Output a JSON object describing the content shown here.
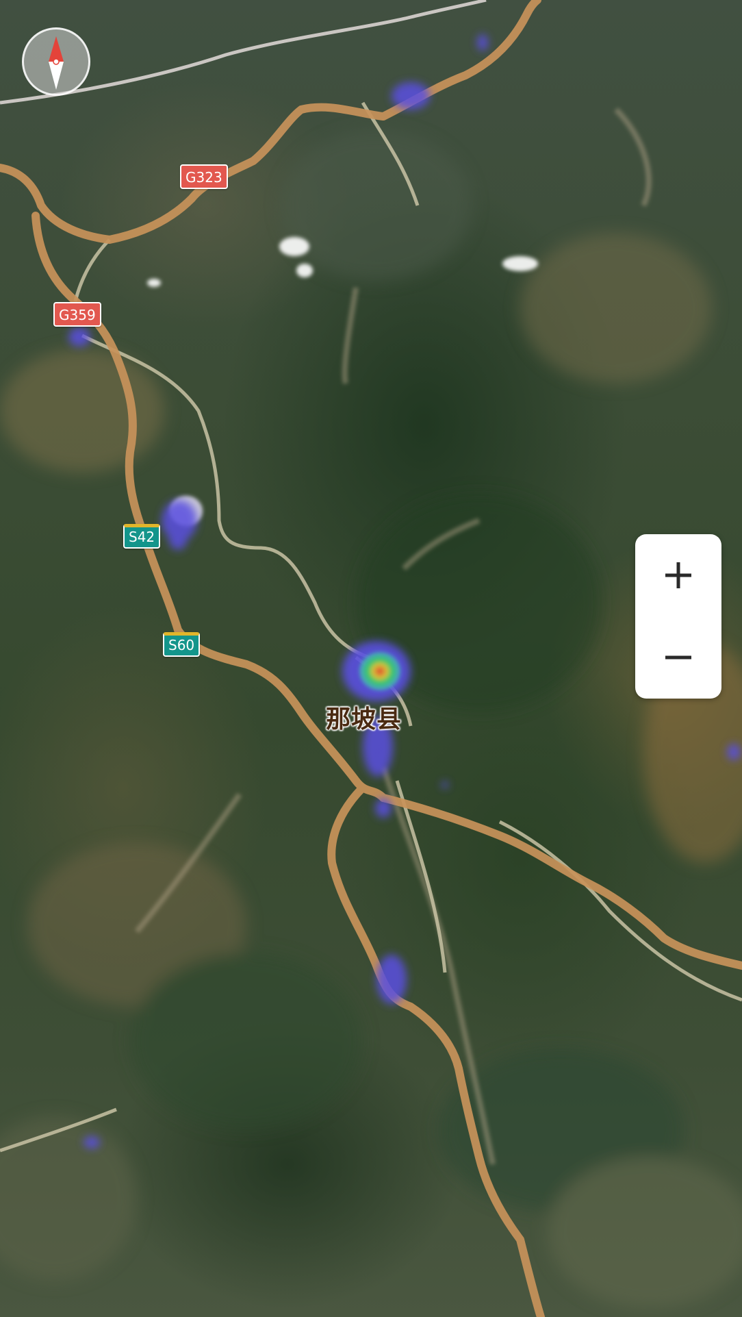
{
  "map": {
    "type": "satellite",
    "place_label": "那坡县",
    "heatmap_overlay": true
  },
  "road_shields": [
    {
      "id": "G323",
      "label": "G323",
      "kind": "national",
      "color": "#e2584f"
    },
    {
      "id": "G359",
      "label": "G359",
      "kind": "national",
      "color": "#e2584f"
    },
    {
      "id": "S42",
      "label": "S42",
      "kind": "provincial",
      "color": "#13958b"
    },
    {
      "id": "S60",
      "label": "S60",
      "kind": "provincial",
      "color": "#13958b"
    }
  ],
  "controls": {
    "compass_icon": "compass-icon",
    "zoom_in_icon": "plus-icon",
    "zoom_out_icon": "minus-icon"
  },
  "colors": {
    "highway": "#c8935a",
    "minor_road": "#c9c3a4",
    "railway": "#d9d3d0",
    "heatmap_low": "#5a4fe0",
    "heatmap_mid": "#37c76a",
    "heatmap_high": "#e0452f"
  }
}
